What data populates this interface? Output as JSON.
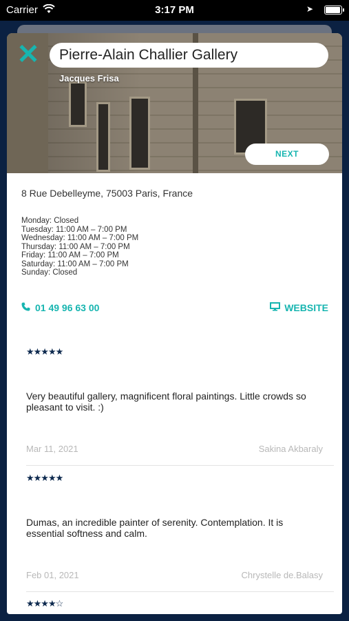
{
  "status_bar": {
    "carrier": "Carrier",
    "time": "3:17 PM"
  },
  "gallery": {
    "name": "Pierre-Alain Challier Gallery",
    "photographer": "Jacques Frisa",
    "next_label": "NEXT",
    "address": "8 Rue Debelleyme, 75003 Paris, France",
    "hours": [
      "Monday: Closed",
      "Tuesday: 11:00 AM – 7:00 PM",
      "Wednesday: 11:00 AM – 7:00 PM",
      "Thursday: 11:00 AM – 7:00 PM",
      "Friday: 11:00 AM – 7:00 PM",
      "Saturday: 11:00 AM – 7:00 PM",
      "Sunday: Closed"
    ],
    "phone": "01 49 96 63 00",
    "website_label": "WEBSITE"
  },
  "reviews": [
    {
      "stars": "★★★★★",
      "rating": 5,
      "text": "Very beautiful gallery, magnificent floral paintings. Little crowds so pleasant to visit. :)",
      "date": "Mar 11, 2021",
      "author": "Sakina Akbaraly"
    },
    {
      "stars": "★★★★★",
      "rating": 5,
      "text": "Dumas, an incredible painter of serenity. Contemplation. It is essential softness and calm.",
      "date": "Feb 01, 2021",
      "author": "Chrystelle de.Balasy"
    },
    {
      "stars": "★★★★☆",
      "rating": 4
    }
  ],
  "colors": {
    "accent": "#17b5b0",
    "navy": "#0e2a4f",
    "background": "#0b2142"
  }
}
